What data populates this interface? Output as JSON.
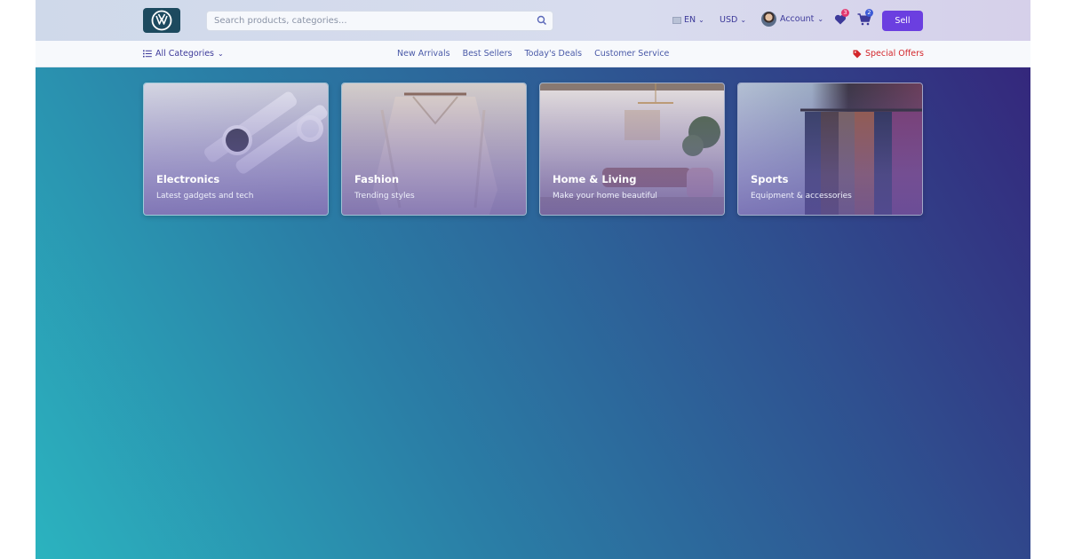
{
  "header": {
    "search_placeholder": "Search products, categories...",
    "language": "EN",
    "currency": "USD",
    "account_label": "Account",
    "wishlist_count": "3",
    "cart_count": "2",
    "sell_label": "Sell"
  },
  "nav": {
    "all_categories": "All Categories",
    "links": [
      "New Arrivals",
      "Best Sellers",
      "Today's Deals",
      "Customer Service"
    ],
    "special_offers": "Special Offers"
  },
  "categories": [
    {
      "title": "Electronics",
      "subtitle": "Latest gadgets and tech"
    },
    {
      "title": "Fashion",
      "subtitle": "Trending styles"
    },
    {
      "title": "Home & Living",
      "subtitle": "Make your home beautiful"
    },
    {
      "title": "Sports",
      "subtitle": "Equipment & accessories"
    }
  ],
  "colors": {
    "accent": "#6b3fe0",
    "link": "#4a5aa8",
    "offers": "#d3262b",
    "badge_wishlist": "#e2386f",
    "badge_cart": "#3d5bd6"
  },
  "icons": [
    "vw-logo",
    "search-icon",
    "flag-icon",
    "chevron-down-icon",
    "avatar",
    "heart-icon",
    "cart-icon",
    "list-icon",
    "tag-icon"
  ]
}
